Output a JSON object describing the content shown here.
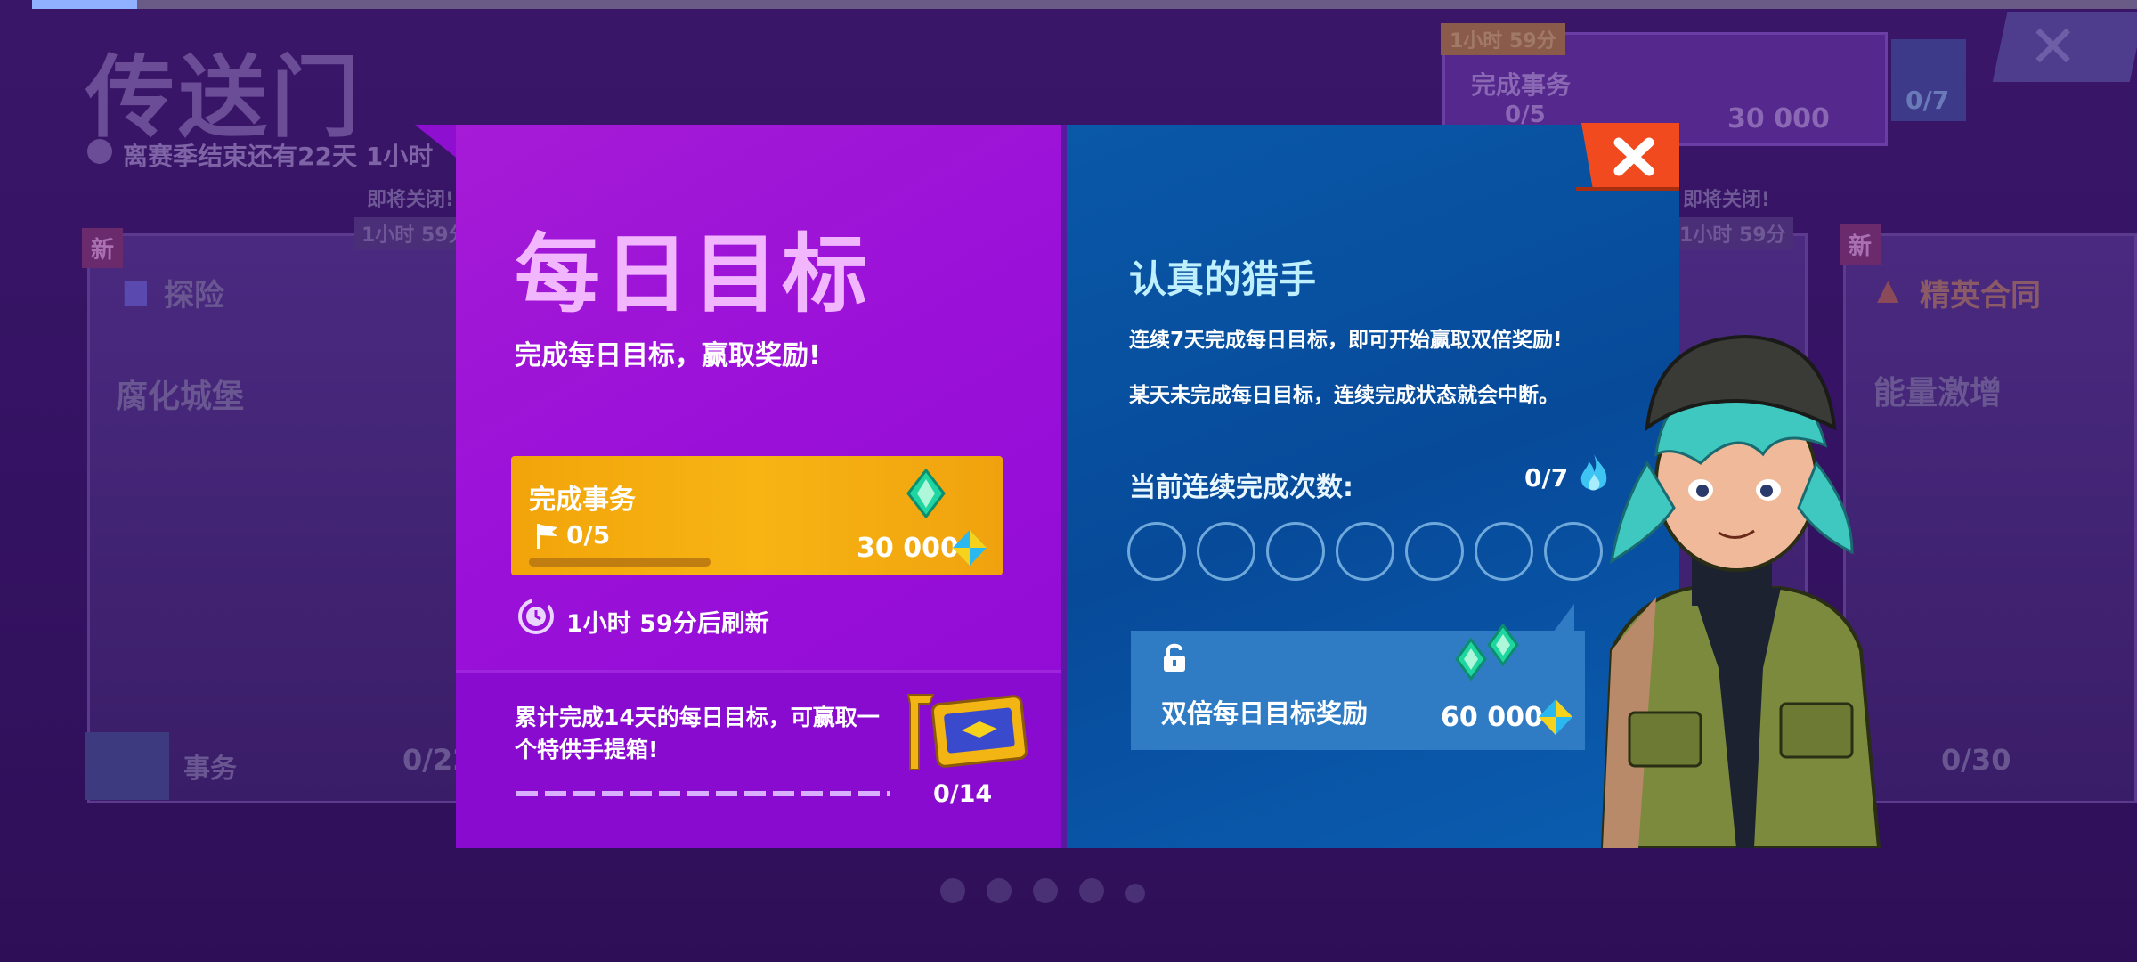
{
  "background": {
    "title": "传送门",
    "season_timer": "离赛季结束还有22天 1小时",
    "cards": [
      {
        "badge": "新",
        "closing_soon": "即将关闭!",
        "closing_time": "1小时 59分",
        "category": "探险",
        "name": "腐化城堡",
        "task_label": "事务",
        "task_count": "0/22"
      },
      {
        "badge": "新",
        "closing_soon": "即将关闭!",
        "closing_time": "1小时 59分",
        "category": "精英合同",
        "name": "能量激增",
        "task_count": "0/30"
      }
    ],
    "top_card": {
      "time": "1小时 59分",
      "task_label": "完成事务",
      "progress": "0/5",
      "reward": "30 000",
      "streak": "0/7"
    }
  },
  "daily": {
    "title": "每日目标",
    "subtitle": "完成每日目标，赢取奖励!",
    "task": {
      "label": "完成事务",
      "progress": "0/5",
      "progress_fraction": 0,
      "reward": "30 000"
    },
    "refresh_text": "1小时 59分后刷新",
    "cumulative": {
      "text": "累计完成14天的每日目标，可赢取一个特供手提箱!",
      "progress": "0/14"
    }
  },
  "hunter": {
    "title": "认真的猎手",
    "line1": "连续7天完成每日目标，即可开始赢取双倍奖励!",
    "line2": "某天未完成每日目标，连续完成状态就会中断。",
    "streak_label": "当前连续完成次数:",
    "streak_count": "0/7",
    "streak_days_filled": 0,
    "double_reward_label": "双倍每日目标奖励",
    "double_reward_amount": "60 000"
  },
  "colors": {
    "daily_panel": "#9a10d8",
    "hunter_panel": "#074a9a",
    "task_card": "#f7b413",
    "close_button": "#f04a1e"
  },
  "icons": {
    "close": "close-icon",
    "flag": "flag-icon",
    "gem": "gem-icon",
    "refresh": "clock-refresh-icon",
    "flame": "flame-icon",
    "lock": "unlock-icon",
    "chest": "suitcase-icon"
  }
}
